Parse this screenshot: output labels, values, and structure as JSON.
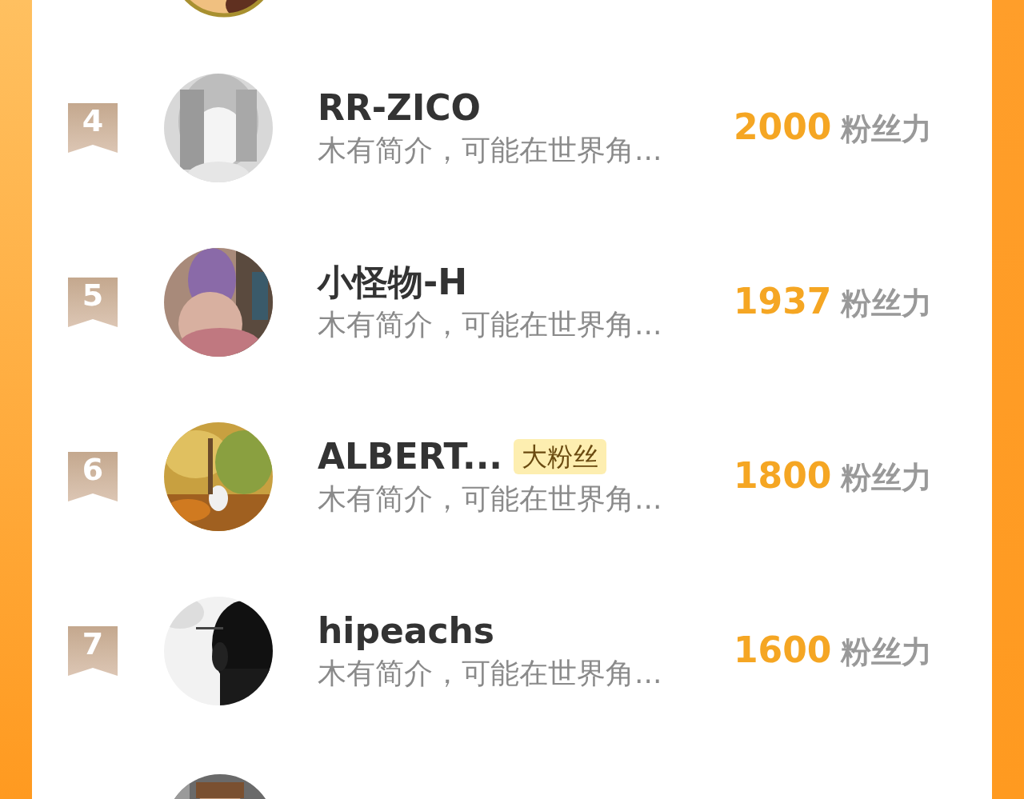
{
  "entries": [
    {
      "rank": "4",
      "name": "RR-ZICO",
      "description": "木有简介，可能在世界角...",
      "score": "2000",
      "unit": "粉丝力"
    },
    {
      "rank": "5",
      "name": "小怪物-H",
      "description": "木有简介，可能在世界角...",
      "score": "1937",
      "unit": "粉丝力"
    },
    {
      "rank": "6",
      "name": "ALBERT...",
      "badge": "大粉丝",
      "description": "木有简介，可能在世界角...",
      "score": "1800",
      "unit": "粉丝力"
    },
    {
      "rank": "7",
      "name": "hipeachs",
      "description": "木有简介，可能在世界角...",
      "score": "1600",
      "unit": "粉丝力"
    }
  ]
}
